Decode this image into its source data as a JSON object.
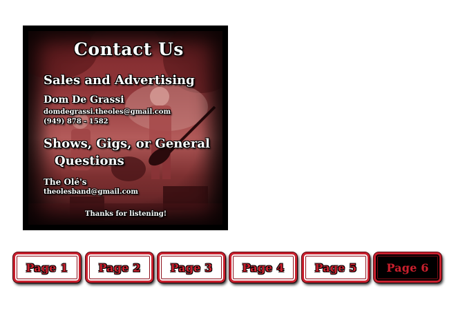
{
  "contact": {
    "title": "Contact Us",
    "sales_heading": "Sales and Advertising",
    "sales_name": "Dom De Grassi",
    "sales_email": "domdegrassi.theoles@gmail.com",
    "sales_phone": "(949) 878 - 1582",
    "shows_heading_line1": "Shows, Gigs, or General",
    "shows_heading_line2": "Questions",
    "band_name": "The Olé's",
    "band_email": "theolesband@gmail.com",
    "thanks": "Thanks for listening!"
  },
  "nav": {
    "pages": [
      {
        "label": "Page 1",
        "active": false
      },
      {
        "label": "Page 2",
        "active": false
      },
      {
        "label": "Page 3",
        "active": false
      },
      {
        "label": "Page 4",
        "active": false
      },
      {
        "label": "Page 5",
        "active": false
      },
      {
        "label": "Page 6",
        "active": true
      }
    ]
  },
  "colors": {
    "accent_red": "#c8202e",
    "photo_tint": "#8f3538"
  }
}
